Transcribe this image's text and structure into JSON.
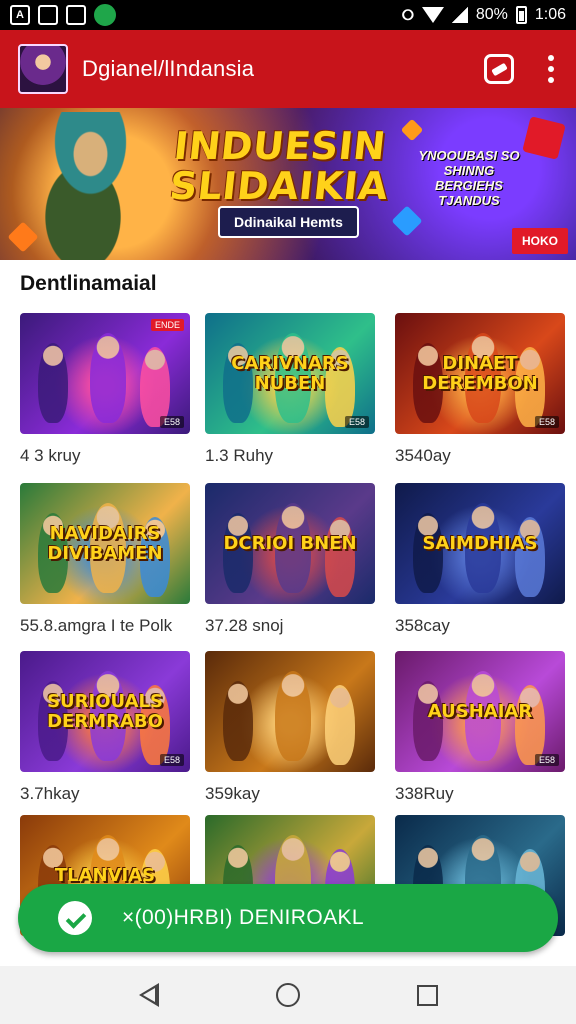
{
  "status_bar": {
    "battery": "80%",
    "time": "1:06",
    "left_icons": [
      "A",
      "",
      "",
      ""
    ],
    "accent": "#000000"
  },
  "app_bar": {
    "title": "Dgianel/lIndansia",
    "color": "#c8141b",
    "share_icon": "share-icon",
    "menu_icon": "more-vert-icon"
  },
  "banner": {
    "title_line1": "INDUESIN",
    "title_line2": "SLIDAIKIA",
    "pill": "Ddinaikal Hemts",
    "side_text": "YNOOUBASI SO SHINNG BERGIEHS TJANDUS",
    "tag": "HOKO"
  },
  "section": {
    "title": "Dentlinamaial"
  },
  "games": [
    {
      "caption": "4 3 kruy",
      "thumb_text": "",
      "badge": "E58",
      "top_badge": "ENDE"
    },
    {
      "caption": "1.3 Ruhy",
      "thumb_text": "CARIVNARS NUBEN",
      "badge": "E58",
      "top_badge": ""
    },
    {
      "caption": "3540ay",
      "thumb_text": "DINAET DEREMBON",
      "badge": "E58",
      "top_badge": ""
    },
    {
      "caption": "55.8.amgra I te Polk",
      "thumb_text": "NAVIDAIRS DIVIBAMEN",
      "badge": "",
      "top_badge": ""
    },
    {
      "caption": "37.28 snoj",
      "thumb_text": "DCRIOI BNEN",
      "badge": "",
      "top_badge": ""
    },
    {
      "caption": "358cay",
      "thumb_text": "SAIMDHIAS",
      "badge": "",
      "top_badge": ""
    },
    {
      "caption": "3.7hkay",
      "thumb_text": "SURIOUALS DERMRABO",
      "badge": "E58",
      "top_badge": ""
    },
    {
      "caption": "359kay",
      "thumb_text": "",
      "badge": "",
      "top_badge": ""
    },
    {
      "caption": "338Ruy",
      "thumb_text": "AUSHAIAR",
      "badge": "E58",
      "top_badge": ""
    },
    {
      "caption": "",
      "thumb_text": "TLANVIAS",
      "badge": "",
      "top_badge": ""
    },
    {
      "caption": "",
      "thumb_text": "",
      "badge": "",
      "top_badge": ""
    },
    {
      "caption": "",
      "thumb_text": "",
      "badge": "",
      "top_badge": ""
    }
  ],
  "cta": {
    "label": "×(00)HRBI) DENIROAKL",
    "color": "#1aa745",
    "icon": "chat-icon"
  },
  "nav": {
    "back_icon": "back-icon",
    "home_icon": "home-icon",
    "recent_icon": "recent-apps-icon"
  }
}
